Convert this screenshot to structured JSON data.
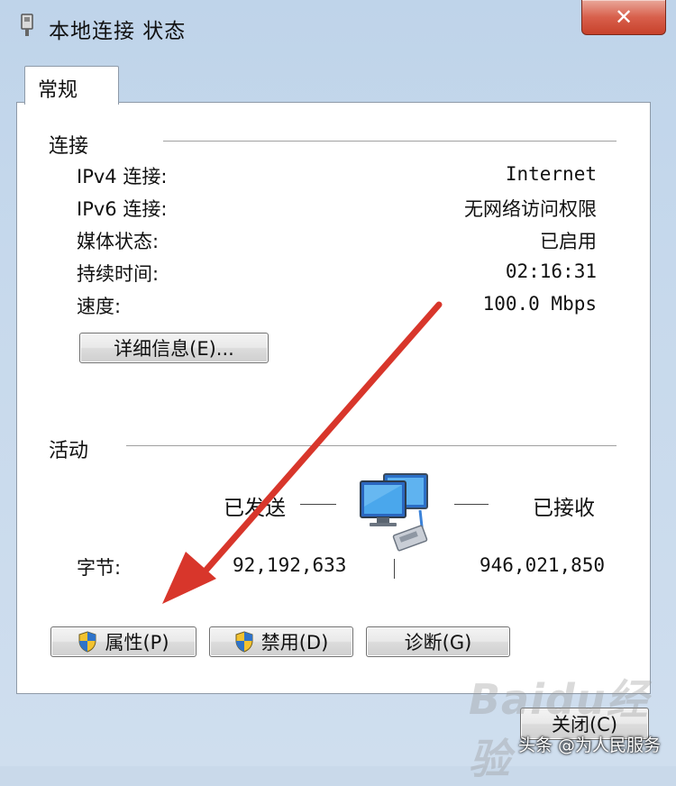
{
  "window": {
    "title": "本地连接 状态",
    "close_glyph": "✕"
  },
  "tabs": [
    {
      "label": "常规"
    }
  ],
  "connection": {
    "section_label": "连接",
    "rows": [
      {
        "label": "IPv4 连接:",
        "value": "Internet"
      },
      {
        "label": "IPv6 连接:",
        "value": "无网络访问权限"
      },
      {
        "label": "媒体状态:",
        "value": "已启用"
      },
      {
        "label": "持续时间:",
        "value": "02:16:31"
      },
      {
        "label": "速度:",
        "value": "100.0 Mbps"
      }
    ],
    "details_button": "详细信息(E)..."
  },
  "activity": {
    "section_label": "活动",
    "sent_label": "已发送",
    "received_label": "已接收",
    "bytes_label": "字节:",
    "bytes_sent": "92,192,633",
    "bytes_received": "946,021,850"
  },
  "buttons": {
    "properties": "属性(P)",
    "disable": "禁用(D)",
    "diagnose": "诊断(G)",
    "close": "关闭(C)"
  },
  "overlay": {
    "watermark": "Baidu经验",
    "credit": "头条 @为人民服务"
  },
  "colors": {
    "arrow": "#d8362b",
    "close_button": "#c7412b"
  }
}
